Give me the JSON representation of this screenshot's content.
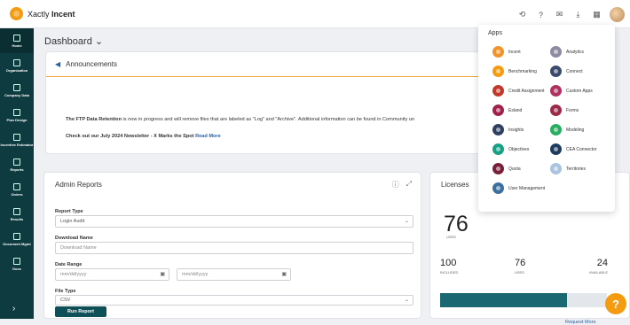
{
  "header": {
    "brand_prefix": "Xactly ",
    "brand_name": "Incent"
  },
  "sidebar": {
    "items": [
      "Home",
      "Organization",
      "Company Data",
      "Plan Design",
      "Incentive Estimator",
      "Reports",
      "Orders",
      "Results",
      "Document Mgmt",
      "Docs"
    ]
  },
  "page": {
    "title": "Dashboard",
    "title_chevron": "⌄"
  },
  "announcements": {
    "title": "Announcements",
    "line1_bold": "The FTP Data Retention",
    "line1_rest": " is now in progress and will remove files that are labeled as \"Log\" and \"Archive\". Additional information can be found in Community un",
    "line2_bold": "Check out our July 2024 Newsletter - X Marks the Spot",
    "line2_link": "Read More"
  },
  "admin_reports": {
    "title": "Admin Reports",
    "report_type_label": "Report Type",
    "report_type_value": "Login Audit",
    "download_name_label": "Download Name",
    "download_name_placeholder": "Download Name",
    "date_range_label": "Date Range",
    "date_placeholder": "mm/dd/yyyy",
    "file_type_label": "File Type",
    "file_type_value": "CSV",
    "run_label": "Run Report"
  },
  "licenses": {
    "title": "Licenses",
    "used_big": "76",
    "used_big_label": "USED",
    "included": "100",
    "included_label": "INCLUDED",
    "used": "76",
    "used_label": "USED",
    "available": "24",
    "available_label": "AVAILABLE",
    "progress": 0.76,
    "request_more": "Request More"
  },
  "apps": {
    "title": "Apps",
    "items": [
      {
        "label": "Incent",
        "color": "#f0932b"
      },
      {
        "label": "Analytics",
        "color": "#8e8aa3"
      },
      {
        "label": "Benchmarking",
        "color": "#f39c12"
      },
      {
        "label": "Connect",
        "color": "#3b4a6b"
      },
      {
        "label": "Credit Assignment",
        "color": "#c0392b"
      },
      {
        "label": "Custom Apps",
        "color": "#b03060"
      },
      {
        "label": "Esland",
        "color": "#a0224a"
      },
      {
        "label": "Forms",
        "color": "#9b2a4a"
      },
      {
        "label": "Insights",
        "color": "#2f3f5f"
      },
      {
        "label": "Modeling",
        "color": "#27ae60"
      },
      {
        "label": "Objectives",
        "color": "#16a085"
      },
      {
        "label": "CEA Connector",
        "color": "#1f3a5f"
      },
      {
        "label": "Quota",
        "color": "#7a1f3a"
      },
      {
        "label": "Territories",
        "color": "#a9c4e0"
      },
      {
        "label": "User Management",
        "color": "#3d6f9e"
      }
    ]
  },
  "help": {
    "label": "?"
  }
}
